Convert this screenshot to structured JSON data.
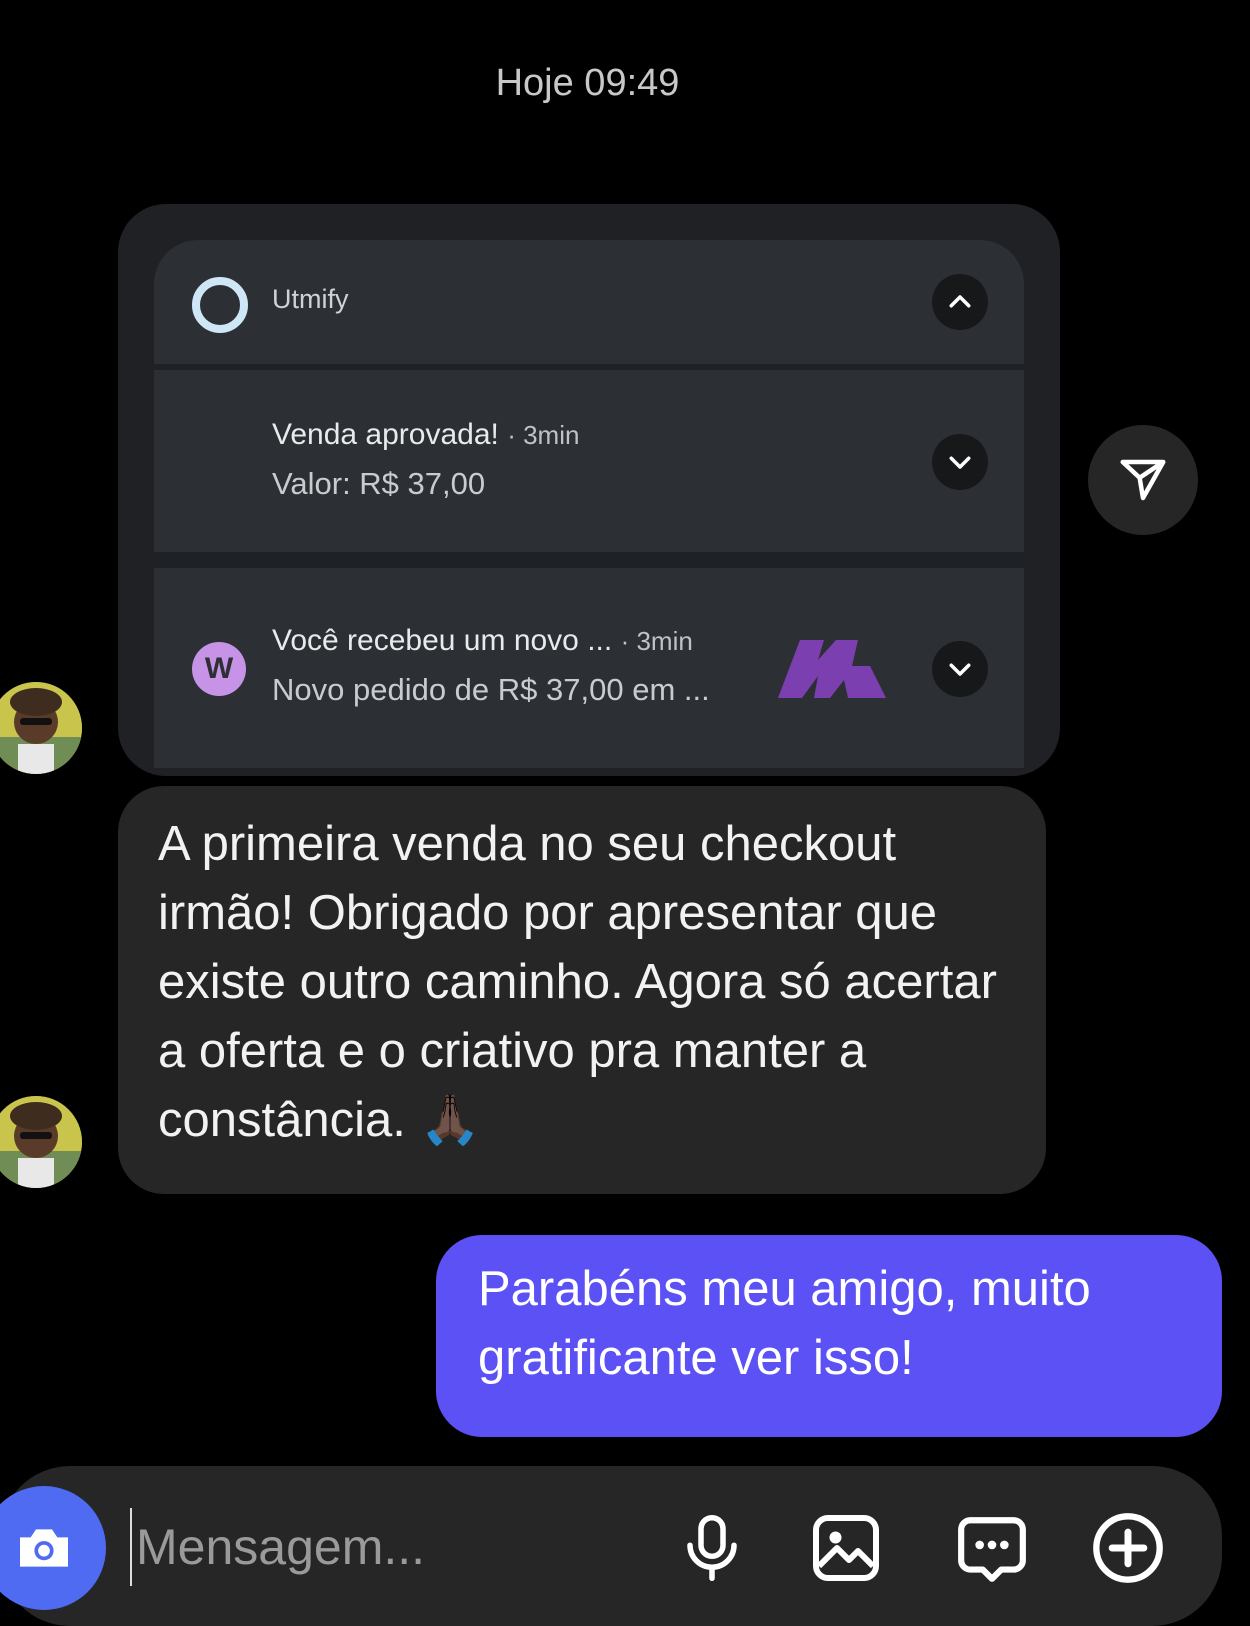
{
  "timestamp": "Hoje 09:49",
  "shared_notification": {
    "app_name": "Utmify",
    "notifications": [
      {
        "title": "Venda aprovada!",
        "time": "· 3min",
        "body": "Valor: R$ 37,00"
      },
      {
        "title": "Você recebeu um novo ...",
        "time": "· 3min",
        "body": "Novo pedido de R$ 37,00 em ...",
        "badge": "W"
      }
    ]
  },
  "messages": {
    "incoming": "A primeira venda no seu checkout irmão! Obrigado por apresentar que existe outro caminho. Agora só acertar a oferta e o criativo pra manter a constância. 🙏🏿",
    "outgoing": "Parabéns meu amigo, muito gratificante ver isso!"
  },
  "composer": {
    "placeholder": "Mensagem..."
  },
  "colors": {
    "outgoing_bubble": "#5b51f4",
    "incoming_bubble": "#262626",
    "camera_button": "#4f6bf2",
    "w_badge": "#c693e6",
    "m_logo": "#7c3fb0"
  },
  "icons": [
    "app-ring-icon",
    "chevron-up-icon",
    "chevron-down-icon",
    "w-badge-icon",
    "m-logo-icon",
    "send-icon",
    "camera-icon",
    "mic-icon",
    "gallery-icon",
    "sticker-icon",
    "plus-icon"
  ]
}
